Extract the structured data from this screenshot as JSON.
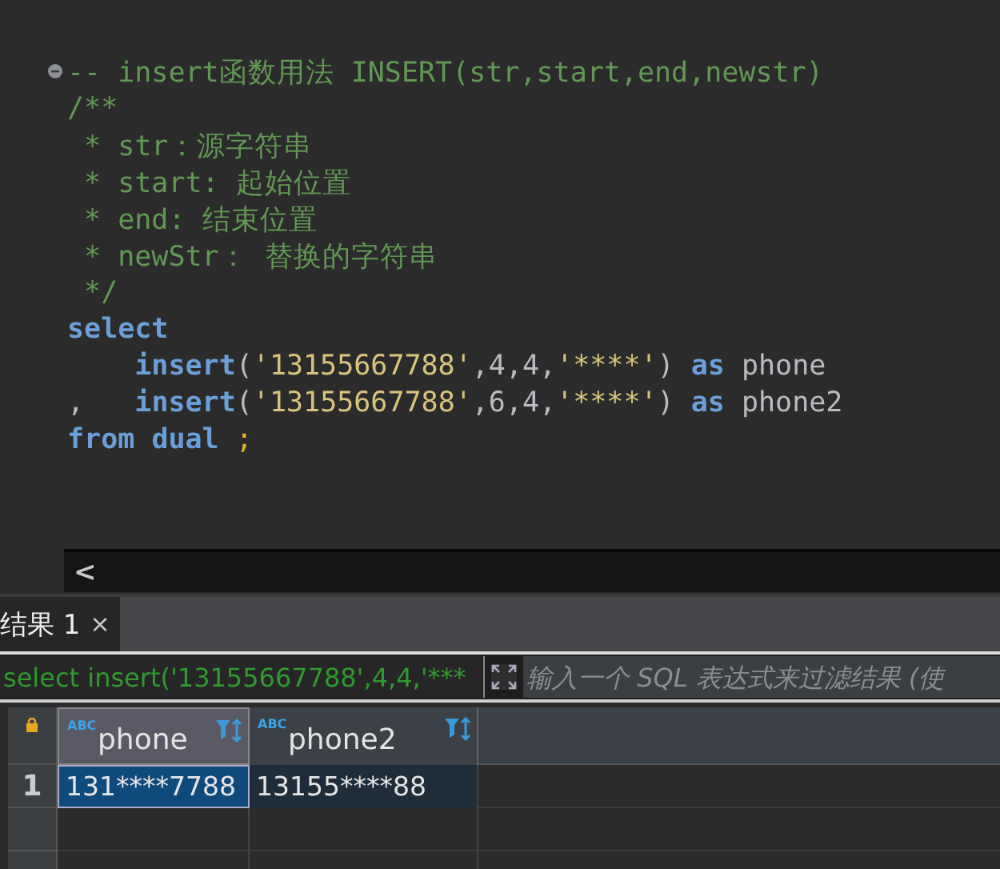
{
  "editor": {
    "lines": [
      {
        "fold_marker": true,
        "tokens": [
          {
            "text": "-- insert函数用法 INSERT(str,start,end,newstr)",
            "kind": "comment"
          }
        ]
      },
      {
        "fold_marker": false,
        "tokens": [
          {
            "text": "/**",
            "kind": "comment"
          }
        ]
      },
      {
        "fold_marker": false,
        "tokens": [
          {
            "text": " * str：源字符串",
            "kind": "comment"
          }
        ]
      },
      {
        "fold_marker": false,
        "tokens": [
          {
            "text": " * start: 起始位置",
            "kind": "comment"
          }
        ]
      },
      {
        "fold_marker": false,
        "tokens": [
          {
            "text": " * end: 结束位置",
            "kind": "comment"
          }
        ]
      },
      {
        "fold_marker": false,
        "tokens": [
          {
            "text": " * newStr： 替换的字符串",
            "kind": "comment"
          }
        ]
      },
      {
        "fold_marker": false,
        "tokens": [
          {
            "text": " */",
            "kind": "comment"
          }
        ]
      },
      {
        "fold_marker": false,
        "tokens": [
          {
            "text": "select",
            "kind": "keyword"
          }
        ]
      },
      {
        "fold_marker": false,
        "tokens": [
          {
            "text": "    insert",
            "kind": "keyword"
          },
          {
            "text": "(",
            "kind": "plain"
          },
          {
            "text": "'13155667788'",
            "kind": "string"
          },
          {
            "text": ",4,4,",
            "kind": "plain"
          },
          {
            "text": "'****'",
            "kind": "string"
          },
          {
            "text": ") ",
            "kind": "plain"
          },
          {
            "text": "as",
            "kind": "keyword"
          },
          {
            "text": " phone",
            "kind": "plain"
          }
        ]
      },
      {
        "fold_marker": false,
        "tokens": [
          {
            "text": ",   ",
            "kind": "plain"
          },
          {
            "text": "insert",
            "kind": "keyword"
          },
          {
            "text": "(",
            "kind": "plain"
          },
          {
            "text": "'13155667788'",
            "kind": "string"
          },
          {
            "text": ",6,4,",
            "kind": "plain"
          },
          {
            "text": "'****'",
            "kind": "string"
          },
          {
            "text": ") ",
            "kind": "plain"
          },
          {
            "text": "as",
            "kind": "keyword"
          },
          {
            "text": " phone2",
            "kind": "plain"
          }
        ]
      },
      {
        "fold_marker": false,
        "tokens": [
          {
            "text": "from",
            "kind": "keyword"
          },
          {
            "text": " dual",
            "kind": "keyword"
          },
          {
            "text": " ;",
            "kind": "punct"
          }
        ]
      }
    ],
    "scroll_left": "<"
  },
  "results": {
    "tabs": [
      {
        "label": "结果 1",
        "close": "×",
        "selected": true
      }
    ],
    "filter": {
      "value": "select insert('13155667788',4,4,'***",
      "placeholder": "输入一个 SQL 表达式来过滤结果 (使"
    },
    "columns": [
      {
        "type_label": "ABC",
        "name": "phone",
        "selected": true
      },
      {
        "type_label": "ABC",
        "name": "phone2",
        "selected": false
      }
    ],
    "rows": [
      {
        "number": "1",
        "cells": [
          {
            "text": "131****7788",
            "selected": true
          },
          {
            "text": "13155****88",
            "selected": false
          }
        ]
      }
    ]
  }
}
